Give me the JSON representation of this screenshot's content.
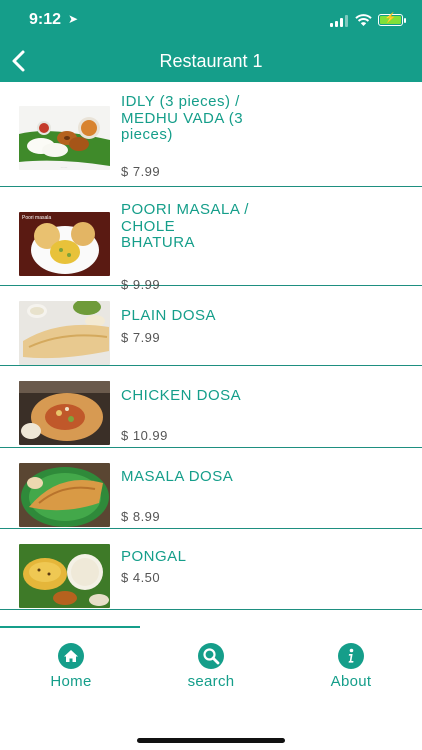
{
  "status_bar": {
    "time": "9:12",
    "location_glyph": "➤"
  },
  "header": {
    "title": "Restaurant 1",
    "back_icon": "chevron-left-icon"
  },
  "menu": {
    "items": [
      {
        "name": "IDLY (3 pieces) / MEDHU VADA (3 pieces)",
        "price": "$ 7.99"
      },
      {
        "name": "POORI MASALA / CHOLE BHATURA",
        "price": "$ 9.99",
        "image_caption": "Poori masala"
      },
      {
        "name": "PLAIN DOSA",
        "price": "$ 7.99"
      },
      {
        "name": "CHICKEN DOSA",
        "price": "$ 10.99"
      },
      {
        "name": "MASALA DOSA",
        "price": "$ 8.99"
      },
      {
        "name": "PONGAL",
        "price": "$ 4.50"
      }
    ]
  },
  "tabs": [
    {
      "label": "Home",
      "icon": "home-icon"
    },
    {
      "label": "search",
      "icon": "search-icon"
    },
    {
      "label": "About",
      "icon": "info-icon"
    }
  ],
  "colors": {
    "accent": "#159e8a",
    "price": "#555555",
    "battery": "#7fe03a"
  }
}
